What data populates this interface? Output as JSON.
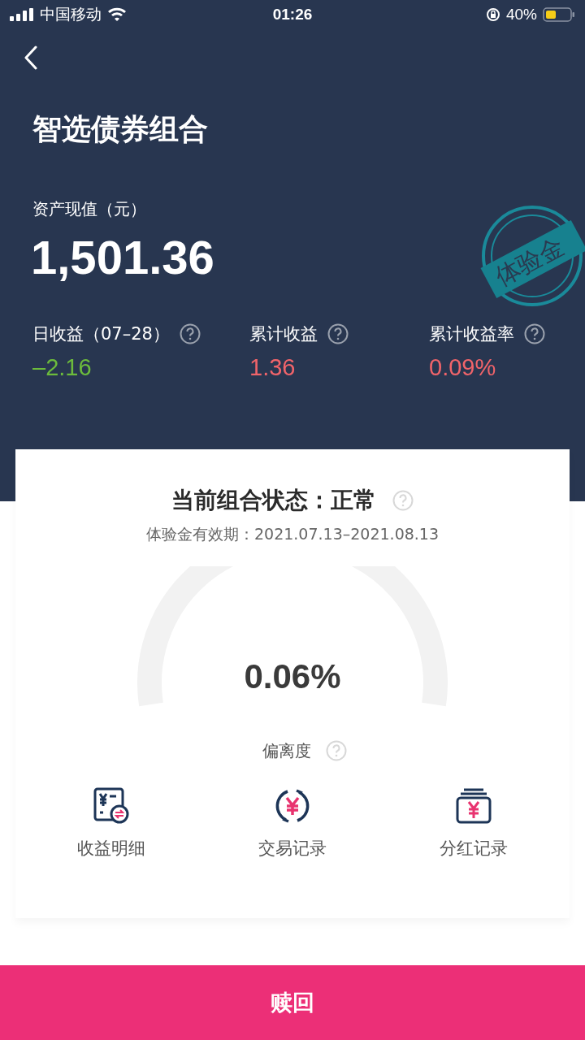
{
  "status_bar": {
    "carrier": "中国移动",
    "time": "01:26",
    "battery": "40%"
  },
  "header": {
    "title": "智选债券组合",
    "asset_label": "资产现值（元）",
    "asset_value": "1,501.36",
    "stamp": "体验金"
  },
  "stats": [
    {
      "label": "日收益（07–28）",
      "value": "–2.16",
      "color": "#6cbb3c"
    },
    {
      "label": "累计收益",
      "value": "1.36",
      "color": "#f0646a"
    },
    {
      "label": "累计收益率",
      "value": "0.09%",
      "color": "#f0646a"
    }
  ],
  "card": {
    "status": "当前组合状态：正常",
    "validity": "体验金有效期：2021.07.13–2021.08.13",
    "gauge_value": "0.06%",
    "gauge_label": "偏离度"
  },
  "actions": [
    {
      "kind": "detail",
      "label": "收益明细"
    },
    {
      "kind": "trade",
      "label": "交易记录"
    },
    {
      "kind": "dividend",
      "label": "分红记录"
    }
  ],
  "redeem_button": "赎回"
}
